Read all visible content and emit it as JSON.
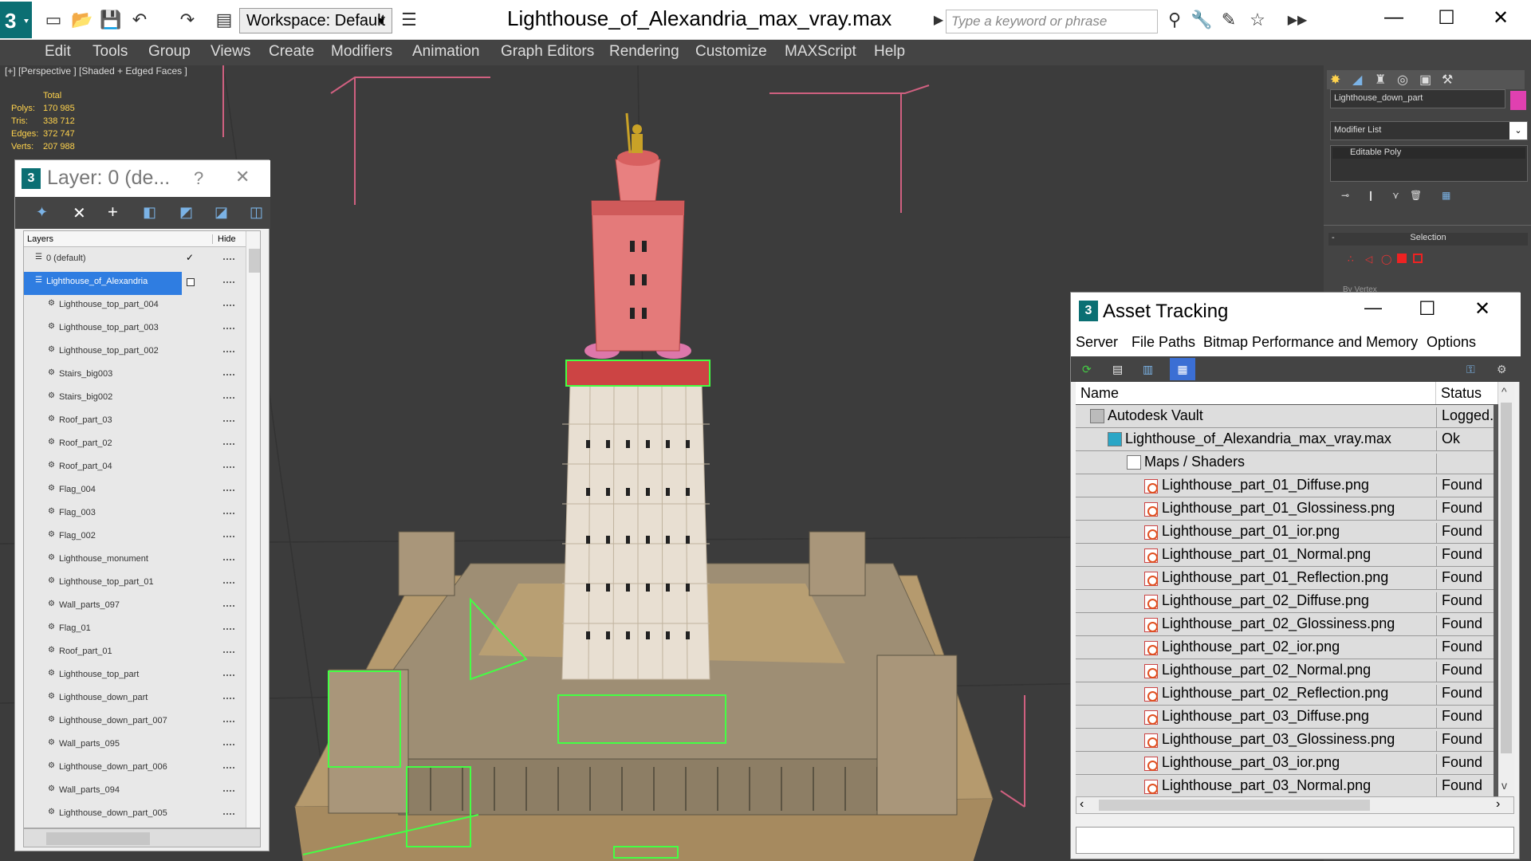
{
  "titlebar": {
    "workspace": "Workspace: Default",
    "doc_title": "Lighthouse_of_Alexandria_max_vray.max",
    "search_placeholder": "Type a keyword or phrase"
  },
  "menu": [
    "Edit",
    "Tools",
    "Group",
    "Views",
    "Create",
    "Modifiers",
    "Animation",
    "Graph Editors",
    "Rendering",
    "Customize",
    "MAXScript",
    "Help"
  ],
  "viewport": {
    "label": "[+] [Perspective ] [Shaded + Edged Faces ]",
    "stats": {
      "header": "Total",
      "rows": [
        {
          "label": "Polys:",
          "value": "170 985"
        },
        {
          "label": "Tris:",
          "value": "338 712"
        },
        {
          "label": "Edges:",
          "value": "372 747"
        },
        {
          "label": "Verts:",
          "value": "207 988"
        }
      ]
    }
  },
  "layer_panel": {
    "title": "Layer: 0 (de...",
    "help": "?",
    "close": "✕",
    "col_layers": "Layers",
    "col_hide": "Hide",
    "rows": [
      "0 (default)",
      "Lighthouse_of_Alexandria",
      "Lighthouse_top_part_004",
      "Lighthouse_top_part_003",
      "Lighthouse_top_part_002",
      "Stairs_big003",
      "Stairs_big002",
      "Roof_part_03",
      "Roof_part_02",
      "Roof_part_04",
      "Flag_004",
      "Flag_003",
      "Flag_002",
      "Lighthouse_monument",
      "Lighthouse_top_part_01",
      "Wall_parts_097",
      "Flag_01",
      "Roof_part_01",
      "Lighthouse_top_part",
      "Lighthouse_down_part",
      "Lighthouse_down_part_007",
      "Wall_parts_095",
      "Lighthouse_down_part_006",
      "Wall_parts_094",
      "Lighthouse_down_part_005"
    ]
  },
  "command_panel": {
    "object_name": "Lighthouse_down_part",
    "modifier_list": "Modifier List",
    "stack_item": "Editable Poly",
    "rollout": "Selection",
    "rollout_sub": "By Vertex",
    "swatch_color": "#e040b0"
  },
  "asset_tracking": {
    "title": "Asset Tracking",
    "menu": [
      "Server",
      "File",
      "Paths",
      "Bitmap Performance and Memory",
      "Options"
    ],
    "col_name": "Name",
    "col_status": "Status",
    "rows": [
      {
        "name": "Autodesk Vault",
        "status": "Logged."
      },
      {
        "name": "Lighthouse_of_Alexandria_max_vray.max",
        "status": "Ok"
      },
      {
        "name": "Maps / Shaders",
        "status": ""
      },
      {
        "name": "Lighthouse_part_01_Diffuse.png",
        "status": "Found"
      },
      {
        "name": "Lighthouse_part_01_Glossiness.png",
        "status": "Found"
      },
      {
        "name": "Lighthouse_part_01_ior.png",
        "status": "Found"
      },
      {
        "name": "Lighthouse_part_01_Normal.png",
        "status": "Found"
      },
      {
        "name": "Lighthouse_part_01_Reflection.png",
        "status": "Found"
      },
      {
        "name": "Lighthouse_part_02_Diffuse.png",
        "status": "Found"
      },
      {
        "name": "Lighthouse_part_02_Glossiness.png",
        "status": "Found"
      },
      {
        "name": "Lighthouse_part_02_ior.png",
        "status": "Found"
      },
      {
        "name": "Lighthouse_part_02_Normal.png",
        "status": "Found"
      },
      {
        "name": "Lighthouse_part_02_Reflection.png",
        "status": "Found"
      },
      {
        "name": "Lighthouse_part_03_Diffuse.png",
        "status": "Found"
      },
      {
        "name": "Lighthouse_part_03_Glossiness.png",
        "status": "Found"
      },
      {
        "name": "Lighthouse_part_03_ior.png",
        "status": "Found"
      },
      {
        "name": "Lighthouse_part_03_Normal.png",
        "status": "Found"
      }
    ]
  }
}
